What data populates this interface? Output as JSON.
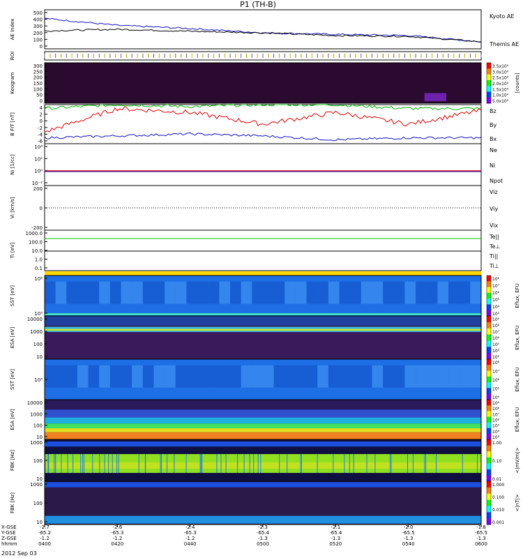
{
  "title": "P1 (TH-B)",
  "date_label": "2012 Sep 03",
  "colors": {
    "blue": "#1010c0",
    "red": "#e00000",
    "green": "#00c000",
    "black": "#000000",
    "spec_bg": "#2a0a2e",
    "spec_blue": "#1e6ee6"
  },
  "panels": [
    {
      "key": "ae",
      "label": "AE Index",
      "ticks": [
        "500",
        "400",
        "300",
        "200",
        "100",
        "0"
      ],
      "legend": [
        "Kyoto AE",
        "Themis AE"
      ]
    },
    {
      "key": "roi",
      "label": "ROI",
      "ticks": []
    },
    {
      "key": "keogram",
      "label": "Keogram",
      "ticks": [
        "300",
        "250",
        "200",
        "150",
        "100",
        "50",
        "0"
      ],
      "colorbar": {
        "ticks": [
          "3.5x10⁴",
          "3.0x10⁴",
          "2.5x10⁴",
          "2.0x10⁴",
          "1.5x10⁴",
          "1.0x10⁴",
          "5.0x10³"
        ],
        "label": "[counts]"
      }
    },
    {
      "key": "bfit",
      "label": "B FIT [nT]",
      "ticks": [
        "4",
        "2",
        "0",
        "-2",
        "-4",
        "-6"
      ],
      "legend": [
        "Bz",
        "By",
        "Bx"
      ]
    },
    {
      "key": "ni",
      "label": "Ni [1/cc]",
      "ticks": [
        "10⁴",
        "10²",
        "10⁰",
        "10⁻²"
      ],
      "legend": [
        "Ne",
        "Ni",
        "Npot"
      ]
    },
    {
      "key": "vi",
      "label": "Vi [km/s]",
      "ticks": [
        "200",
        "0",
        "-200"
      ],
      "legend": [
        "Viz",
        "Viy",
        "Vix"
      ]
    },
    {
      "key": "ti",
      "label": "Ti [eV]",
      "ticks": [
        "1000.0",
        "100.0",
        "10.0",
        "1.0",
        "0.1"
      ],
      "legend": [
        "Te||",
        "Te⊥",
        "Ti||",
        "Ti⊥"
      ]
    },
    {
      "key": "sst_e",
      "label": "SST [eV]",
      "ticks": [
        "10⁶",
        "10⁵"
      ],
      "colorbar": {
        "ticks": [
          "10⁸",
          "10⁷",
          "10⁶",
          "10⁵",
          "10⁴",
          "10³"
        ],
        "label": "Eflux, EFU"
      }
    },
    {
      "key": "esa_e",
      "label": "ESA [eV]",
      "ticks": [
        "10000",
        "1000",
        "100",
        "10"
      ],
      "colorbar": {
        "ticks": [
          "10⁹",
          "10⁸",
          "10⁷",
          "10⁶",
          "10⁵",
          "10⁴",
          "10³"
        ],
        "label": "Eflux, EFU"
      }
    },
    {
      "key": "sst_i",
      "label": "SST [eV]",
      "ticks": [
        "10⁵"
      ],
      "colorbar": {
        "ticks": [
          "10⁸",
          "10⁷",
          "10⁶",
          "10⁵",
          "10⁴"
        ],
        "label": "Eflux, EFU"
      }
    },
    {
      "key": "esa_i",
      "label": "ESA [eV]",
      "ticks": [
        "10000",
        "1000",
        "100",
        "10"
      ],
      "colorbar": {
        "ticks": [
          "10⁹",
          "10⁸",
          "10⁷",
          "10⁶",
          "10⁵",
          "10⁴",
          "10³"
        ],
        "label": "Eflux, EFU"
      }
    },
    {
      "key": "fbk_e",
      "label": "FBK [Hz]",
      "ticks": [
        "1000",
        "100",
        "10"
      ],
      "colorbar": {
        "ticks": [
          "1.00",
          "0.10",
          "0.01"
        ],
        "label": "<|mV/m|>"
      }
    },
    {
      "key": "fbk_b",
      "label": "FBK [Hz]",
      "ticks": [
        "1000",
        "100",
        "10"
      ],
      "colorbar": {
        "ticks": [
          "1.000",
          "0.100",
          "0.010",
          "0.001"
        ],
        "label": "<|nT|>"
      }
    }
  ],
  "xaxis": {
    "row_labels": [
      "X-GSE",
      "Y-GSE",
      "Z-GSE",
      "hhmm"
    ],
    "columns": [
      [
        "-2.7",
        "-65.2",
        "-1.2",
        "0400"
      ],
      [
        "-2.6",
        "-65.3",
        "-1.2",
        "0420"
      ],
      [
        "-2.4",
        "-65.3",
        "-1.2",
        "0440"
      ],
      [
        "-2.3",
        "-65.4",
        "-1.3",
        "0500"
      ],
      [
        "-2.1",
        "-65.4",
        "-1.3",
        "0520"
      ],
      [
        "-2.0",
        "-65.5",
        "-1.3",
        "0540"
      ],
      [
        "-1.8",
        "-65.5",
        "-1.3",
        "0600"
      ]
    ]
  },
  "chart_data": [
    {
      "type": "line",
      "name_key": "ae",
      "x": [
        "0400",
        "0420",
        "0440",
        "0500",
        "0520",
        "0540",
        "0600"
      ],
      "series": [
        {
          "name": "Kyoto AE",
          "values": [
            390,
            300,
            260,
            205,
            185,
            170,
            90
          ]
        },
        {
          "name": "Themis AE",
          "values": [
            230,
            250,
            225,
            205,
            170,
            160,
            90
          ]
        }
      ],
      "ylim": [
        0,
        500
      ]
    },
    {
      "type": "line",
      "name_key": "bfit",
      "x": [
        "0400",
        "0420",
        "0440",
        "0500",
        "0520",
        "0540",
        "0600"
      ],
      "series": [
        {
          "name": "Bz",
          "values": [
            -3,
            3,
            2,
            -1,
            2,
            -1,
            2.5
          ]
        },
        {
          "name": "By",
          "values": [
            3,
            4,
            3.5,
            4,
            4,
            3,
            3
          ]
        },
        {
          "name": "Bx",
          "values": [
            -4.5,
            -4,
            -3.5,
            -4,
            -5,
            -4.5,
            -4.5
          ]
        }
      ],
      "ylim": [
        -6,
        4
      ]
    }
  ]
}
